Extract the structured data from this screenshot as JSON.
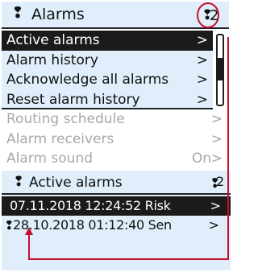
{
  "main_screen": {
    "title": "Alarms",
    "alarm_count": "2",
    "menu": [
      {
        "label": "Active alarms",
        "arrow": ">"
      },
      {
        "label": "Alarm history",
        "arrow": ">"
      },
      {
        "label": "Acknowledge all alarms",
        "arrow": ">"
      },
      {
        "label": "Reset alarm history",
        "arrow": ">"
      },
      {
        "label": "Routing schedule",
        "arrow": ">"
      },
      {
        "label": "Alarm receivers",
        "arrow": ">"
      },
      {
        "label": "Alarm sound",
        "value": "On",
        "arrow": ">"
      }
    ]
  },
  "active_screen": {
    "title": "Active alarms",
    "alarm_count": "2",
    "alarms": [
      {
        "text": "07.11.2018 12:24:52 Risk",
        "arrow": ">"
      },
      {
        "text": "28.10.2018 01:12:40 Sen",
        "arrow": ">"
      }
    ]
  },
  "icons": {
    "bell": "alarm-bell-icon"
  },
  "colors": {
    "screen_bg": "#dfeefa",
    "selected_bg": "#1b1b1b",
    "disabled_text": "#a8a8a8",
    "highlight": "#c8102e"
  }
}
